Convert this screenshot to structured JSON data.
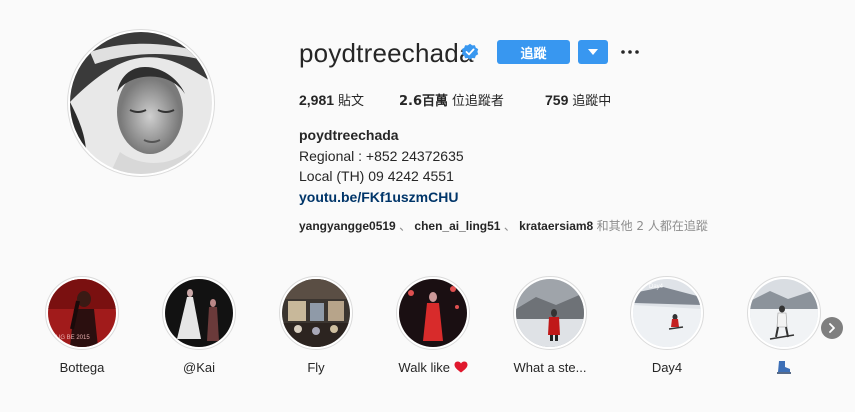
{
  "profile": {
    "username": "poydtreechada",
    "follow_label": "追蹤",
    "stats": {
      "posts_count": "2,981",
      "posts_label": "貼文",
      "followers_count": "2.6百萬",
      "followers_label": "位追蹤者",
      "following_count": "759",
      "following_label": "追蹤中"
    },
    "bio": {
      "name": "poydtreechada",
      "line1": "Regional : +852 24372635",
      "line2": "Local (TH) 09 4242 4551",
      "link": "youtu.be/FKf1uszmCHU"
    },
    "followed_by": {
      "users": [
        "yangyangge0519",
        "chen_ai_ling51",
        "krataersiam8"
      ],
      "separator": "、",
      "suffix": "和其他 2 人都在追蹤"
    }
  },
  "highlights": [
    {
      "label": "Bottega"
    },
    {
      "label": "@Kai"
    },
    {
      "label": "Fly"
    },
    {
      "label": "Walk like"
    },
    {
      "label": "What a ste..."
    },
    {
      "label": "Day4"
    },
    {
      "label": ""
    }
  ],
  "colors": {
    "accent": "#3897f0",
    "link": "#003569",
    "text": "#262626",
    "muted": "#8e8e8e",
    "background": "#fafafa"
  },
  "icons": {
    "verified": "verified-badge-icon",
    "dropdown": "chevron-down-icon",
    "more": "more-options-icon",
    "next": "chevron-right-icon",
    "heart": "red-heart-emoji",
    "ski": "ski-boot-emoji"
  }
}
